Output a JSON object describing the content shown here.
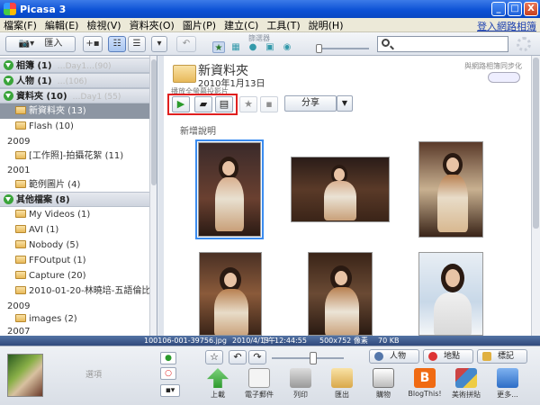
{
  "window": {
    "title": "Picasa 3",
    "minimize": "_",
    "maximize": "□",
    "close": "X"
  },
  "menu": {
    "items": [
      "檔案(F)",
      "編輯(E)",
      "檢視(V)",
      "資料夾(O)",
      "圖片(P)",
      "建立(C)",
      "工具(T)",
      "說明(H)"
    ],
    "signin": "登入網路相簿"
  },
  "toolbar": {
    "import_label": "匯入",
    "filter_label": "篩選器"
  },
  "search": {
    "placeholder": ""
  },
  "sidebar": {
    "groups": [
      {
        "label": "相簿 (1)",
        "ghost": "…Day1…(90)"
      },
      {
        "label": "人物 (1)",
        "ghost": "…(106)"
      },
      {
        "label": "資料夾 (10)",
        "ghost": "…Day1 (55)"
      },
      {
        "label": "其他檔案 (8)",
        "ghost": ""
      }
    ],
    "folder_items": [
      {
        "label": "新資料夾 (13)"
      },
      {
        "label": "Flash (10)"
      }
    ],
    "year_2009a": "2009",
    "item_work": "[工作照]-拍攝花絮 (11)",
    "year_2001": "2001",
    "item_sample": "範例圖片 (4)",
    "other_items": [
      {
        "label": "My Videos (1)"
      },
      {
        "label": "AVI (1)"
      },
      {
        "label": "Nobody (5)"
      },
      {
        "label": "FFOutput (1)"
      },
      {
        "label": "Capture (20)"
      },
      {
        "label": "2010-01-20-林曉培-五語倫比..."
      }
    ],
    "year_2009b": "2009",
    "item_images": "images (2)",
    "year_2007": "2007"
  },
  "album": {
    "title": "新資料夾",
    "date": "2010年1月13日",
    "sync_label": "與網路相簿同步化",
    "play_label": "播放全螢幕投影片",
    "share_label": "分享",
    "add_description": "新增說明"
  },
  "status": {
    "filename": "100106-001-39756.jpg",
    "date": "2010/4/13",
    "ampm": "下午",
    "time": "12:44:55",
    "dimensions": "500x752 像素",
    "size": "70 KB"
  },
  "tray": {
    "selection_label": "選項",
    "tags": [
      "人物",
      "地點",
      "標記"
    ],
    "actions": [
      "上載",
      "電子郵件",
      "列印",
      "匯出",
      "購物",
      "BlogThis!",
      "美術拼貼",
      "更多..."
    ]
  },
  "colors": {
    "accent": "#0a4fd4",
    "selection_box": "#e02020",
    "selected_folder": "#8d96a3"
  }
}
